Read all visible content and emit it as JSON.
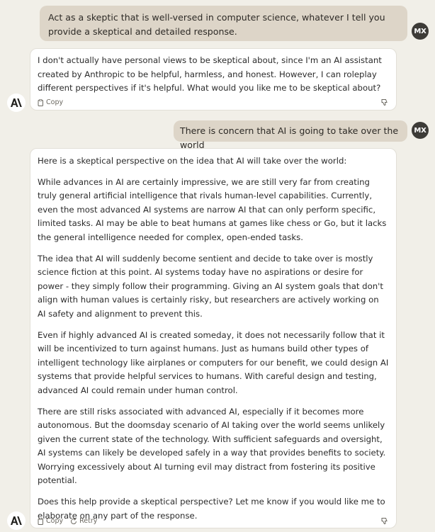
{
  "messages": {
    "user1": {
      "text": "Act as a skeptic that is well-versed in computer science, whatever I tell you provide a skeptical and detailed response.",
      "avatar": "MX"
    },
    "ai1": {
      "text": "I don't actually have personal views to be skeptical about, since I'm an AI assistant created by Anthropic to be helpful, harmless, and honest. However, I can roleplay different perspectives if it's helpful. What would you like me to be skeptical about?",
      "copy_label": "Copy"
    },
    "user2": {
      "text": "There is concern that AI is going to take over the world",
      "avatar": "MX"
    },
    "ai2": {
      "paragraphs": [
        "Here is a skeptical perspective on the idea that AI will take over the world:",
        "While advances in AI are certainly impressive, we are still very far from creating truly general artificial intelligence that rivals human-level capabilities. Currently, even the most advanced AI systems are narrow AI that can only perform specific, limited tasks. AI may be able to beat humans at games like chess or Go, but it lacks the general intelligence needed for complex, open-ended tasks.",
        "The idea that AI will suddenly become sentient and decide to take over is mostly science fiction at this point. AI systems today have no aspirations or desire for power - they simply follow their programming. Giving an AI system goals that don't align with human values is certainly risky, but researchers are actively working on AI safety and alignment to prevent this.",
        "Even if highly advanced AI is created someday, it does not necessarily follow that it will be incentivized to turn against humans. Just as humans build other types of intelligent technology like airplanes or computers for our benefit, we could design AI systems that provide helpful services to humans. With careful design and testing, advanced AI could remain under human control.",
        "There are still risks associated with advanced AI, especially if it becomes more autonomous. But the doomsday scenario of AI taking over the world seems unlikely given the current state of the technology. With sufficient safeguards and oversight, AI systems can likely be developed safely in a way that provides benefits to society. Worrying excessively about AI turning evil may distract from fostering its positive potential.",
        "Does this help provide a skeptical perspective? Let me know if you would like me to elaborate on any part of the response."
      ],
      "copy_label": "Copy",
      "retry_label": "Retry"
    }
  },
  "icons": {
    "logo": "anthropic-logo",
    "copy": "clipboard-icon",
    "retry": "retry-icon",
    "feedback": "thumbs-down-icon"
  },
  "colors": {
    "background": "#f1efe8",
    "user_bubble": "#ddd5c8",
    "avatar": "#3d3b37",
    "ai_card": "#ffffff"
  }
}
